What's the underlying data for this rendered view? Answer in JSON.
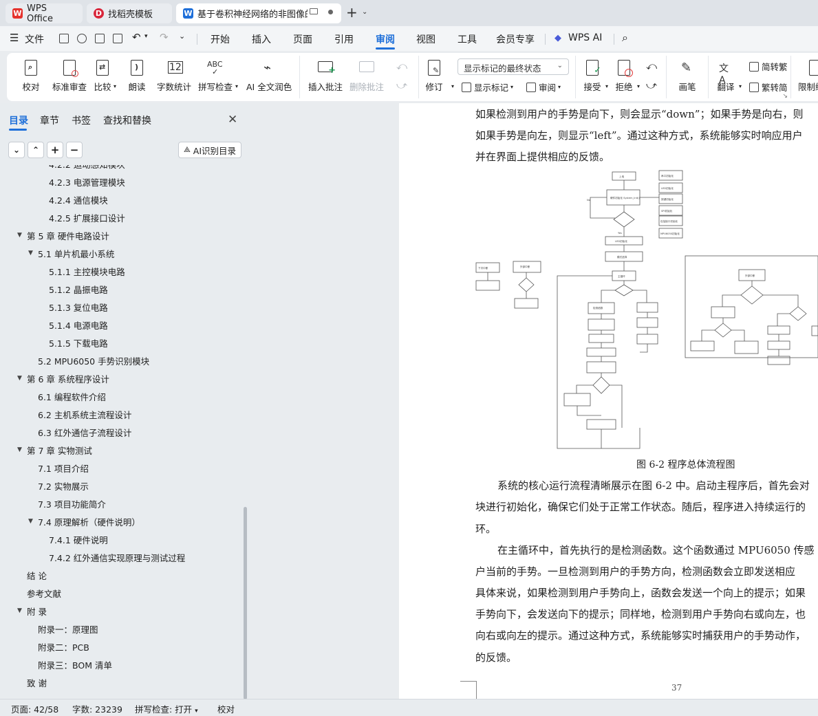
{
  "tabs": [
    {
      "label": "WPS Office",
      "logo": "W"
    },
    {
      "label": "找稻壳模板",
      "logo": "D"
    },
    {
      "label": "基于卷积神经网络的非图像的",
      "logo": "W"
    }
  ],
  "menu": [
    "文件",
    "开始",
    "插入",
    "页面",
    "引用",
    "审阅",
    "视图",
    "工具",
    "会员专享",
    "WPS AI"
  ],
  "ribbon": {
    "proofread": "校对",
    "standard_review": "标准审查",
    "compare": "比较",
    "read_aloud": "朗读",
    "word_count": "字数统计",
    "spell_check": "拼写检查",
    "ai_proofread": "AI 全文润色",
    "insert_comment": "插入批注",
    "delete_comment": "删除批注",
    "markup_select": "显示标记的最终状态",
    "revise": "修订",
    "show_markup": "显示标记",
    "review_pane": "审阅",
    "accept": "接受",
    "reject": "拒绝",
    "pen": "画笔",
    "translate": "翻译",
    "to_traditional": "简转繁",
    "to_simplified": "繁转简",
    "restrict": "限制编辑"
  },
  "nav": {
    "tabs": [
      "目录",
      "章节",
      "书签",
      "查找和替换"
    ],
    "ai_toc": "AI识别目录",
    "toc": [
      {
        "text": "4.2.2  运动感知模块",
        "level": 3
      },
      {
        "text": "4.2.3  电源管理模块",
        "level": 3
      },
      {
        "text": "4.2.4  通信模块",
        "level": 3
      },
      {
        "text": "4.2.5  扩展接口设计",
        "level": 3
      },
      {
        "text": "第 5 章  硬件电路设计",
        "level": 1,
        "expanded": true
      },
      {
        "text": "5.1 单片机最小系统",
        "level": 2,
        "expanded": true
      },
      {
        "text": "5.1.1 主控模块电路",
        "level": 3
      },
      {
        "text": "5.1.2  晶振电路",
        "level": 3
      },
      {
        "text": "5.1.3  复位电路",
        "level": 3
      },
      {
        "text": "5.1.4  电源电路",
        "level": 3
      },
      {
        "text": "5.1.5 下载电路",
        "level": 3
      },
      {
        "text": "5.2 MPU6050 手势识别模块",
        "level": 2
      },
      {
        "text": "第 6 章  系统程序设计",
        "level": 1,
        "expanded": true
      },
      {
        "text": "6.1  编程软件介绍",
        "level": 2
      },
      {
        "text": "6.2  主机系统主流程设计",
        "level": 2
      },
      {
        "text": "6.3  红外通信子流程设计",
        "level": 2
      },
      {
        "text": "第 7 章  实物测试",
        "level": 1,
        "expanded": true
      },
      {
        "text": "7.1  项目介绍",
        "level": 2
      },
      {
        "text": "7.2  实物展示",
        "level": 2
      },
      {
        "text": "7.3  项目功能简介",
        "level": 2
      },
      {
        "text": "7.4  原理解析（硬件说明）",
        "level": 2,
        "expanded": true
      },
      {
        "text": "7.4.1 硬件说明",
        "level": 3
      },
      {
        "text": "7.4.2 红外通信实现原理与测试过程",
        "level": 3
      },
      {
        "text": "结   论",
        "level": 1
      },
      {
        "text": "参考文献",
        "level": 1
      },
      {
        "text": "附   录",
        "level": 1,
        "expanded": true
      },
      {
        "text": "附录一：原理图",
        "level": 2
      },
      {
        "text": "附录二：PCB",
        "level": 2
      },
      {
        "text": "附录三：BOM 清单",
        "level": 2
      },
      {
        "text": "致   谢",
        "level": 1
      }
    ]
  },
  "doc": {
    "lines_top": [
      "如果检测到用户的手势是向下，则会显示“down”；如果手势是向右，则",
      "如果手势是向左，则显示“left”。通过这种方式，系统能够实时响应用户",
      "并在界面上提供相应的反馈。"
    ],
    "caption": "图 6-2   程序总体流程图",
    "lines_bottom": [
      "系统的核心运行流程清晰展示在图 6-2 中。启动主程序后，首先会对",
      "块进行初始化，确保它们处于正常工作状态。随后，程序进入持续运行的",
      "环。",
      "在主循环中，首先执行的是检测函数。这个函数通过 MPU6050 传感",
      "户当前的手势。一旦检测到用户的手势方向，检测函数会立即发送相应",
      "具体来说，如果检测到用户手势向上，函数会发送一个向上的提示；如果",
      "手势向下，会发送向下的提示；同样地，检测到用户手势向右或向左，也",
      "向右或向左的提示。通过这种方式，系统能够实时捕获用户的手势动作，",
      "的反馈。"
    ],
    "page_number": "37",
    "flow_labels": {
      "start": "上电",
      "init": "硬件初始化 System_Init()",
      "yes": "Yes",
      "no": "No",
      "led_init": "LED初始化",
      "mode": "模式选择",
      "main_loop": "主循环",
      "detect": "检测函数",
      "ir_int": "外部中断",
      "period": "下次中断",
      "init_list": [
        "串口初始化",
        "LED初始化",
        "按键初始化",
        "SPI初始化",
        "包括接口初始化",
        "MPU6050初始化"
      ]
    }
  },
  "status": {
    "page": "页面: 42/58",
    "words": "字数: 23239",
    "spell": "拼写检查: 打开",
    "proof": "校对"
  },
  "colors": {
    "accent": "#1e6fd9",
    "wps_red": "#e5322d",
    "docer_red": "#d9263b"
  }
}
